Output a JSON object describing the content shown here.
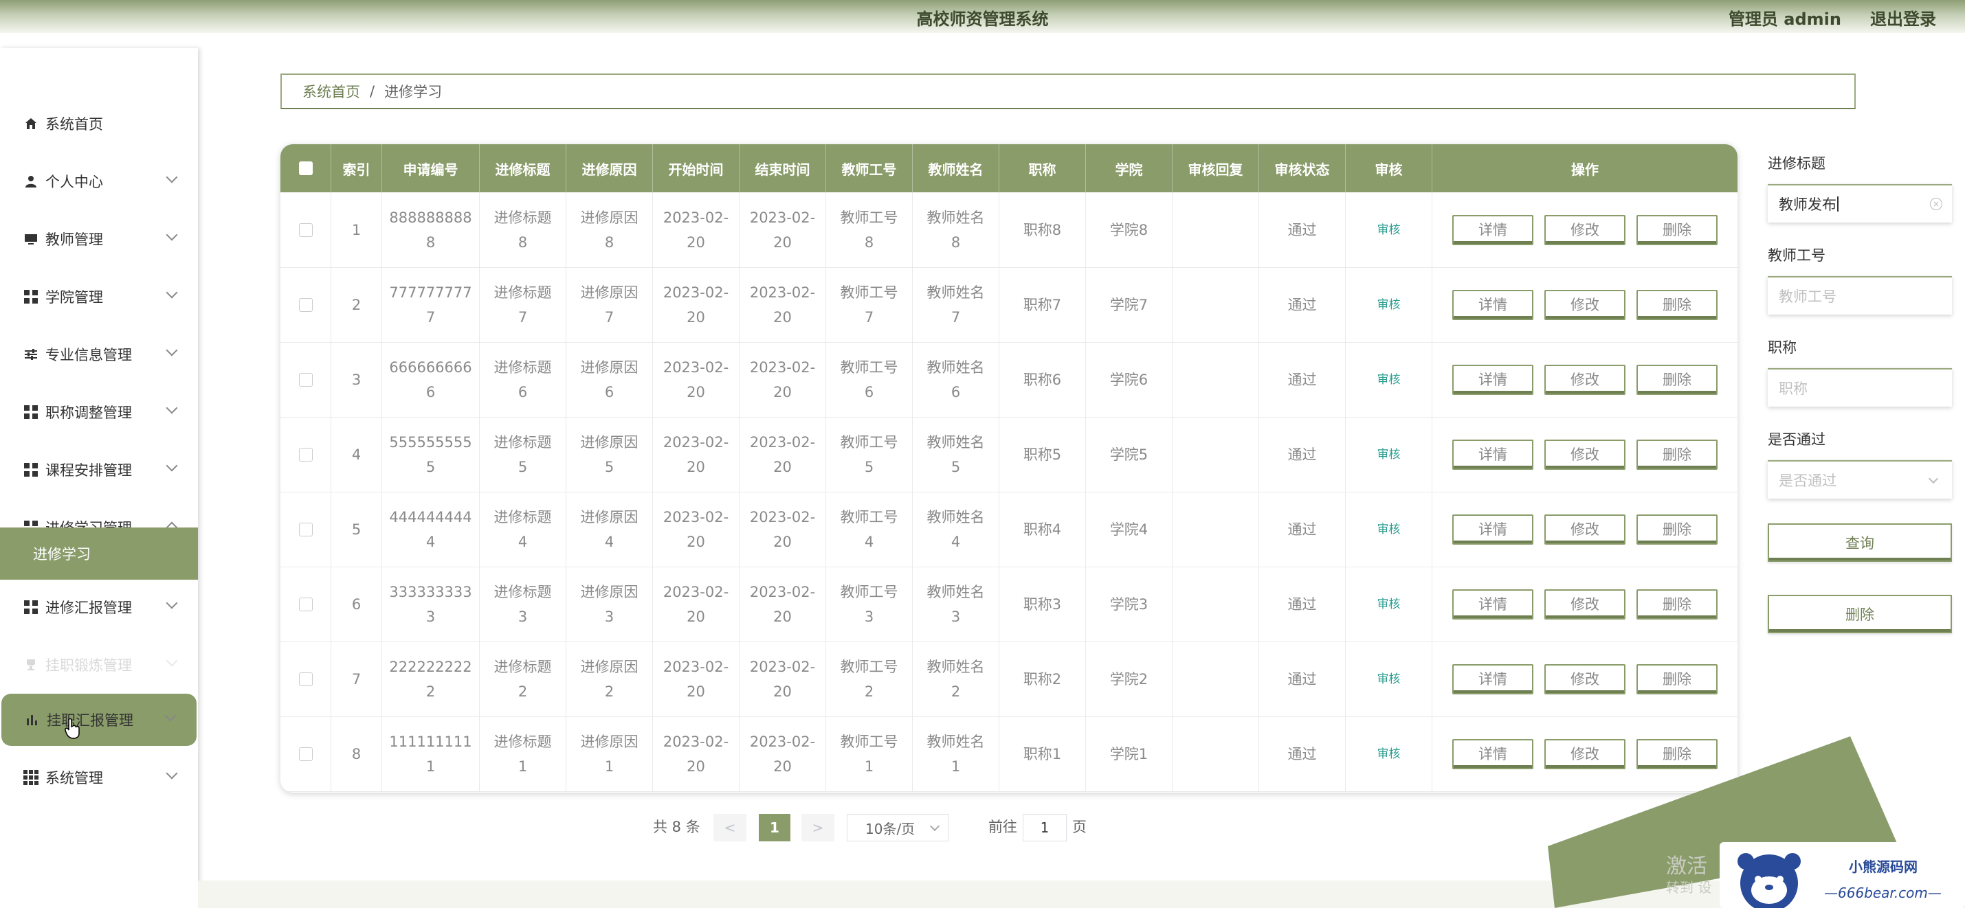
{
  "header": {
    "title": "高校师资管理系统",
    "admin": "管理员 admin",
    "logout": "退出登录"
  },
  "sidebar": {
    "items": [
      {
        "label": "系统首页",
        "icon": "home-icon"
      },
      {
        "label": "个人中心",
        "icon": "user-icon"
      },
      {
        "label": "教师管理",
        "icon": "monitor-icon"
      },
      {
        "label": "学院管理",
        "icon": "grid-icon"
      },
      {
        "label": "专业信息管理",
        "icon": "sliders-icon"
      },
      {
        "label": "职称调整管理",
        "icon": "grid-icon"
      },
      {
        "label": "课程安排管理",
        "icon": "grid-icon"
      },
      {
        "label": "进修学习管理",
        "icon": "grid-icon"
      },
      {
        "label": "进修汇报管理",
        "icon": "grid-icon"
      },
      {
        "label": "挂职锻炼管理",
        "icon": "trophy-icon"
      },
      {
        "label": "挂职汇报管理",
        "icon": "bar-chart-icon"
      },
      {
        "label": "系统管理",
        "icon": "apps-icon"
      }
    ],
    "submenu": {
      "label": "进修学习"
    }
  },
  "breadcrumb": {
    "home": "系统首页",
    "sep": "/",
    "current": "进修学习"
  },
  "table": {
    "headers": [
      "索引",
      "申请编号",
      "进修标题",
      "进修原因",
      "开始时间",
      "结束时间",
      "教师工号",
      "教师姓名",
      "职称",
      "学院",
      "审核回复",
      "审核状态",
      "审核",
      "操作"
    ],
    "rows": [
      {
        "index": "1",
        "code": "888888888\n8",
        "title": "进修标题\n8",
        "reason": "进修原因\n8",
        "start": "2023-02-\n20",
        "end": "2023-02-\n20",
        "tid": "教师工号\n8",
        "tname": "教师姓名\n8",
        "rank": "职称8",
        "college": "学院8",
        "reply": "",
        "status": "通过",
        "audit": "审核"
      },
      {
        "index": "2",
        "code": "777777777\n7",
        "title": "进修标题\n7",
        "reason": "进修原因\n7",
        "start": "2023-02-\n20",
        "end": "2023-02-\n20",
        "tid": "教师工号\n7",
        "tname": "教师姓名\n7",
        "rank": "职称7",
        "college": "学院7",
        "reply": "",
        "status": "通过",
        "audit": "审核"
      },
      {
        "index": "3",
        "code": "666666666\n6",
        "title": "进修标题\n6",
        "reason": "进修原因\n6",
        "start": "2023-02-\n20",
        "end": "2023-02-\n20",
        "tid": "教师工号\n6",
        "tname": "教师姓名\n6",
        "rank": "职称6",
        "college": "学院6",
        "reply": "",
        "status": "通过",
        "audit": "审核"
      },
      {
        "index": "4",
        "code": "555555555\n5",
        "title": "进修标题\n5",
        "reason": "进修原因\n5",
        "start": "2023-02-\n20",
        "end": "2023-02-\n20",
        "tid": "教师工号\n5",
        "tname": "教师姓名\n5",
        "rank": "职称5",
        "college": "学院5",
        "reply": "",
        "status": "通过",
        "audit": "审核"
      },
      {
        "index": "5",
        "code": "444444444\n4",
        "title": "进修标题\n4",
        "reason": "进修原因\n4",
        "start": "2023-02-\n20",
        "end": "2023-02-\n20",
        "tid": "教师工号\n4",
        "tname": "教师姓名\n4",
        "rank": "职称4",
        "college": "学院4",
        "reply": "",
        "status": "通过",
        "audit": "审核"
      },
      {
        "index": "6",
        "code": "333333333\n3",
        "title": "进修标题\n3",
        "reason": "进修原因\n3",
        "start": "2023-02-\n20",
        "end": "2023-02-\n20",
        "tid": "教师工号\n3",
        "tname": "教师姓名\n3",
        "rank": "职称3",
        "college": "学院3",
        "reply": "",
        "status": "通过",
        "audit": "审核"
      },
      {
        "index": "7",
        "code": "222222222\n2",
        "title": "进修标题\n2",
        "reason": "进修原因\n2",
        "start": "2023-02-\n20",
        "end": "2023-02-\n20",
        "tid": "教师工号\n2",
        "tname": "教师姓名\n2",
        "rank": "职称2",
        "college": "学院2",
        "reply": "",
        "status": "通过",
        "audit": "审核"
      },
      {
        "index": "8",
        "code": "111111111\n1",
        "title": "进修标题\n1",
        "reason": "进修原因\n1",
        "start": "2023-02-\n20",
        "end": "2023-02-\n20",
        "tid": "教师工号\n1",
        "tname": "教师姓名\n1",
        "rank": "职称1",
        "college": "学院1",
        "reply": "",
        "status": "通过",
        "audit": "审核"
      }
    ],
    "actions": {
      "detail": "详情",
      "edit": "修改",
      "delete": "删除"
    }
  },
  "pagination": {
    "total": "共 8 条",
    "prev": "<",
    "current_page": "1",
    "next": ">",
    "page_size": "10条/页",
    "goto_prefix": "前往",
    "goto_value": "1",
    "goto_suffix": "页"
  },
  "search": {
    "title_label": "进修标题",
    "title_value": "教师发布",
    "tid_label": "教师工号",
    "tid_placeholder": "教师工号",
    "rank_label": "职称",
    "rank_placeholder": "职称",
    "pass_label": "是否通过",
    "pass_placeholder": "是否通过",
    "query_button": "查询",
    "delete_button": "删除"
  },
  "overlay": {
    "activate_line1": "激活",
    "activate_line2": "转到 设",
    "brand": "小熊源码网",
    "brand_url": "—666bear.com—"
  },
  "colors": {
    "accent": "#8a9c6a",
    "accent_dark": "#6e7f52",
    "audit_link": "#2a9d8f"
  }
}
